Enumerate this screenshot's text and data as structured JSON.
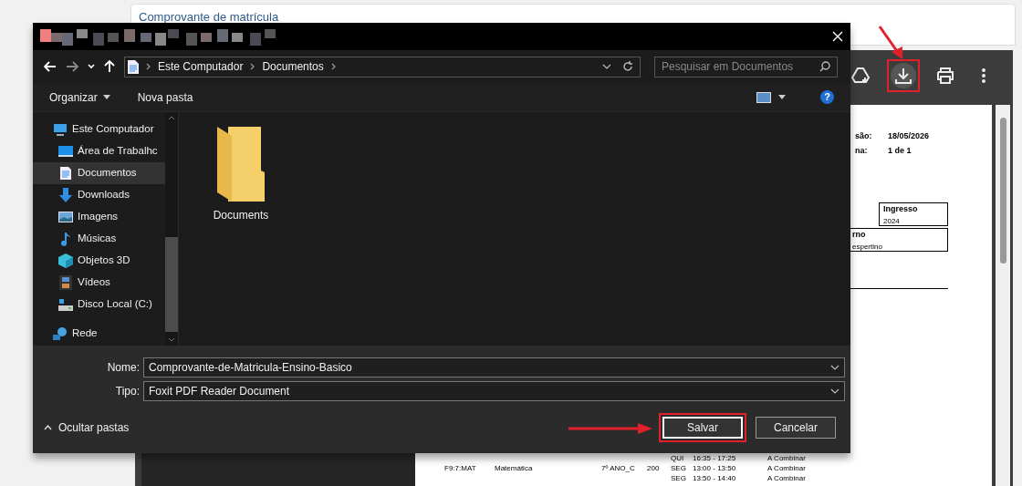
{
  "page": {
    "title": "Comprovante de matrícula"
  },
  "pdf_toolbar": [
    {
      "kind": "drive",
      "highlighted": false
    },
    {
      "kind": "download",
      "highlighted": true
    },
    {
      "kind": "print",
      "highlighted": false
    },
    {
      "kind": "more",
      "highlighted": false
    }
  ],
  "document": {
    "fields": [
      {
        "label": "são:",
        "value": "18/05/2026"
      },
      {
        "label": "na:",
        "value": "1 de 1"
      }
    ],
    "cells": [
      {
        "label": "Ingresso",
        "value": "2024"
      },
      {
        "label": "rno",
        "value": "espertino"
      }
    ],
    "schedule": [
      {
        "day": "QUI",
        "time": "16:35 - 17:25",
        "place": "A Combinar"
      },
      {
        "code": "F9:7:MAT",
        "subject": "Matemática",
        "class": "7º ANO_C",
        "number": "200",
        "day": "SEG",
        "time": "13:00 - 13:50",
        "place": "A Combinar"
      },
      {
        "day": "SEG",
        "time": "13:50 - 14:40",
        "place": "A Combinar"
      }
    ]
  },
  "dialog": {
    "breadcrumbs": [
      "Este Computador",
      "Documentos"
    ],
    "search_placeholder": "Pesquisar em Documentos",
    "toolbar": {
      "organize": "Organizar",
      "new_folder": "Nova pasta",
      "help": "?"
    },
    "sidebar": [
      {
        "label": "Este Computador",
        "kind": "pc",
        "selected": false,
        "children": [
          {
            "label": "Área de Trabalhc",
            "kind": "desktop",
            "selected": false
          },
          {
            "label": "Documentos",
            "kind": "documents",
            "selected": true
          },
          {
            "label": "Downloads",
            "kind": "downloads",
            "selected": false
          },
          {
            "label": "Imagens",
            "kind": "images",
            "selected": false
          },
          {
            "label": "Músicas",
            "kind": "music",
            "selected": false
          },
          {
            "label": "Objetos 3D",
            "kind": "objects3d",
            "selected": false
          },
          {
            "label": "Vídeos",
            "kind": "videos",
            "selected": false
          },
          {
            "label": "Disco Local (C:)",
            "kind": "disk",
            "selected": false
          }
        ]
      },
      {
        "label": "Rede",
        "kind": "network",
        "selected": false
      }
    ],
    "items": [
      {
        "name": "Documents"
      }
    ],
    "fields": [
      {
        "label": "Nome:",
        "value": "Comprovante-de-Matricula-Ensino-Basico"
      },
      {
        "label": "Tipo:",
        "value": "Foxit PDF Reader Document"
      }
    ],
    "toggle_folders": "Ocultar pastas",
    "buttons": [
      {
        "label": "Salvar",
        "highlighted": true
      },
      {
        "label": "Cancelar",
        "highlighted": false
      }
    ]
  }
}
